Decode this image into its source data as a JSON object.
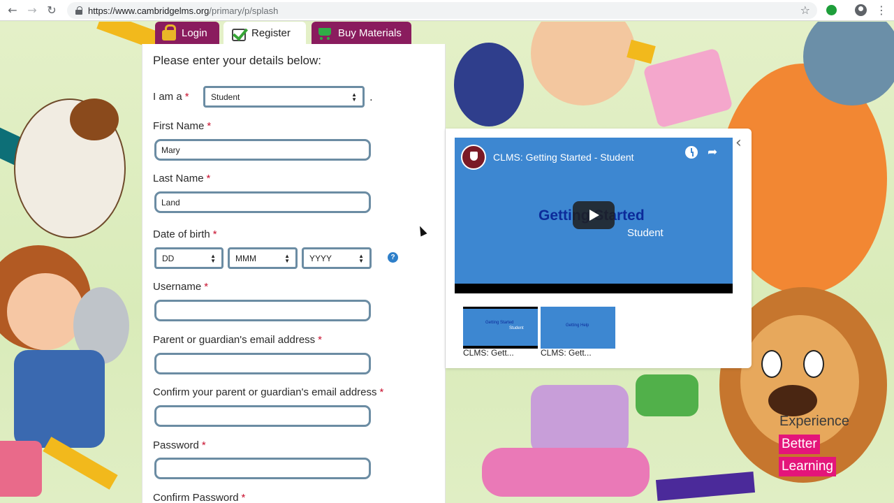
{
  "browser": {
    "url_host": "https://www.cambridgelms.org",
    "url_path": "/primary/p/splash",
    "back_glyph": "←",
    "forward_glyph": "→",
    "reload_glyph": "↻",
    "star_glyph": "☆",
    "menu_glyph": "⋮"
  },
  "tabs": {
    "login": "Login",
    "register": "Register",
    "buy": "Buy Materials"
  },
  "form": {
    "intro": "Please enter your details below:",
    "required_mark": "*",
    "role_label": "I am a",
    "role_value": "Student",
    "role_suffix": ".",
    "first_name_label": "First Name",
    "first_name_value": "Mary",
    "last_name_label": "Last Name",
    "last_name_value": "Land",
    "dob_label": "Date of birth",
    "dob_day": "DD",
    "dob_month": "MMM",
    "dob_year": "YYYY",
    "help_glyph": "?",
    "username_label": "Username",
    "parent_email_label": "Parent or guardian's email address",
    "confirm_parent_email_label": "Confirm your parent or guardian's email address",
    "password_label": "Password",
    "confirm_password_label": "Confirm Password"
  },
  "video": {
    "title": "CLMS: Getting Started - Student",
    "frame_title": "Getting Started",
    "frame_subtitle": "Student",
    "collapse_glyph": "‹",
    "share_glyph": "➦",
    "thumbnails": [
      {
        "caption": "CLMS: Gett...",
        "text": "Getting Started",
        "sub": "Student"
      },
      {
        "caption": "CLMS: Gett...",
        "text": "Getting Help",
        "sub": ""
      }
    ]
  },
  "promo": {
    "line1": "Experience",
    "line2": "Better",
    "line3": "Learning"
  },
  "colors": {
    "tab_accent": "#8a1c5e",
    "field_border": "#6b8ca3",
    "required": "#c8102e",
    "promo_pink": "#e4157a",
    "video_blue": "#3d87d1"
  }
}
